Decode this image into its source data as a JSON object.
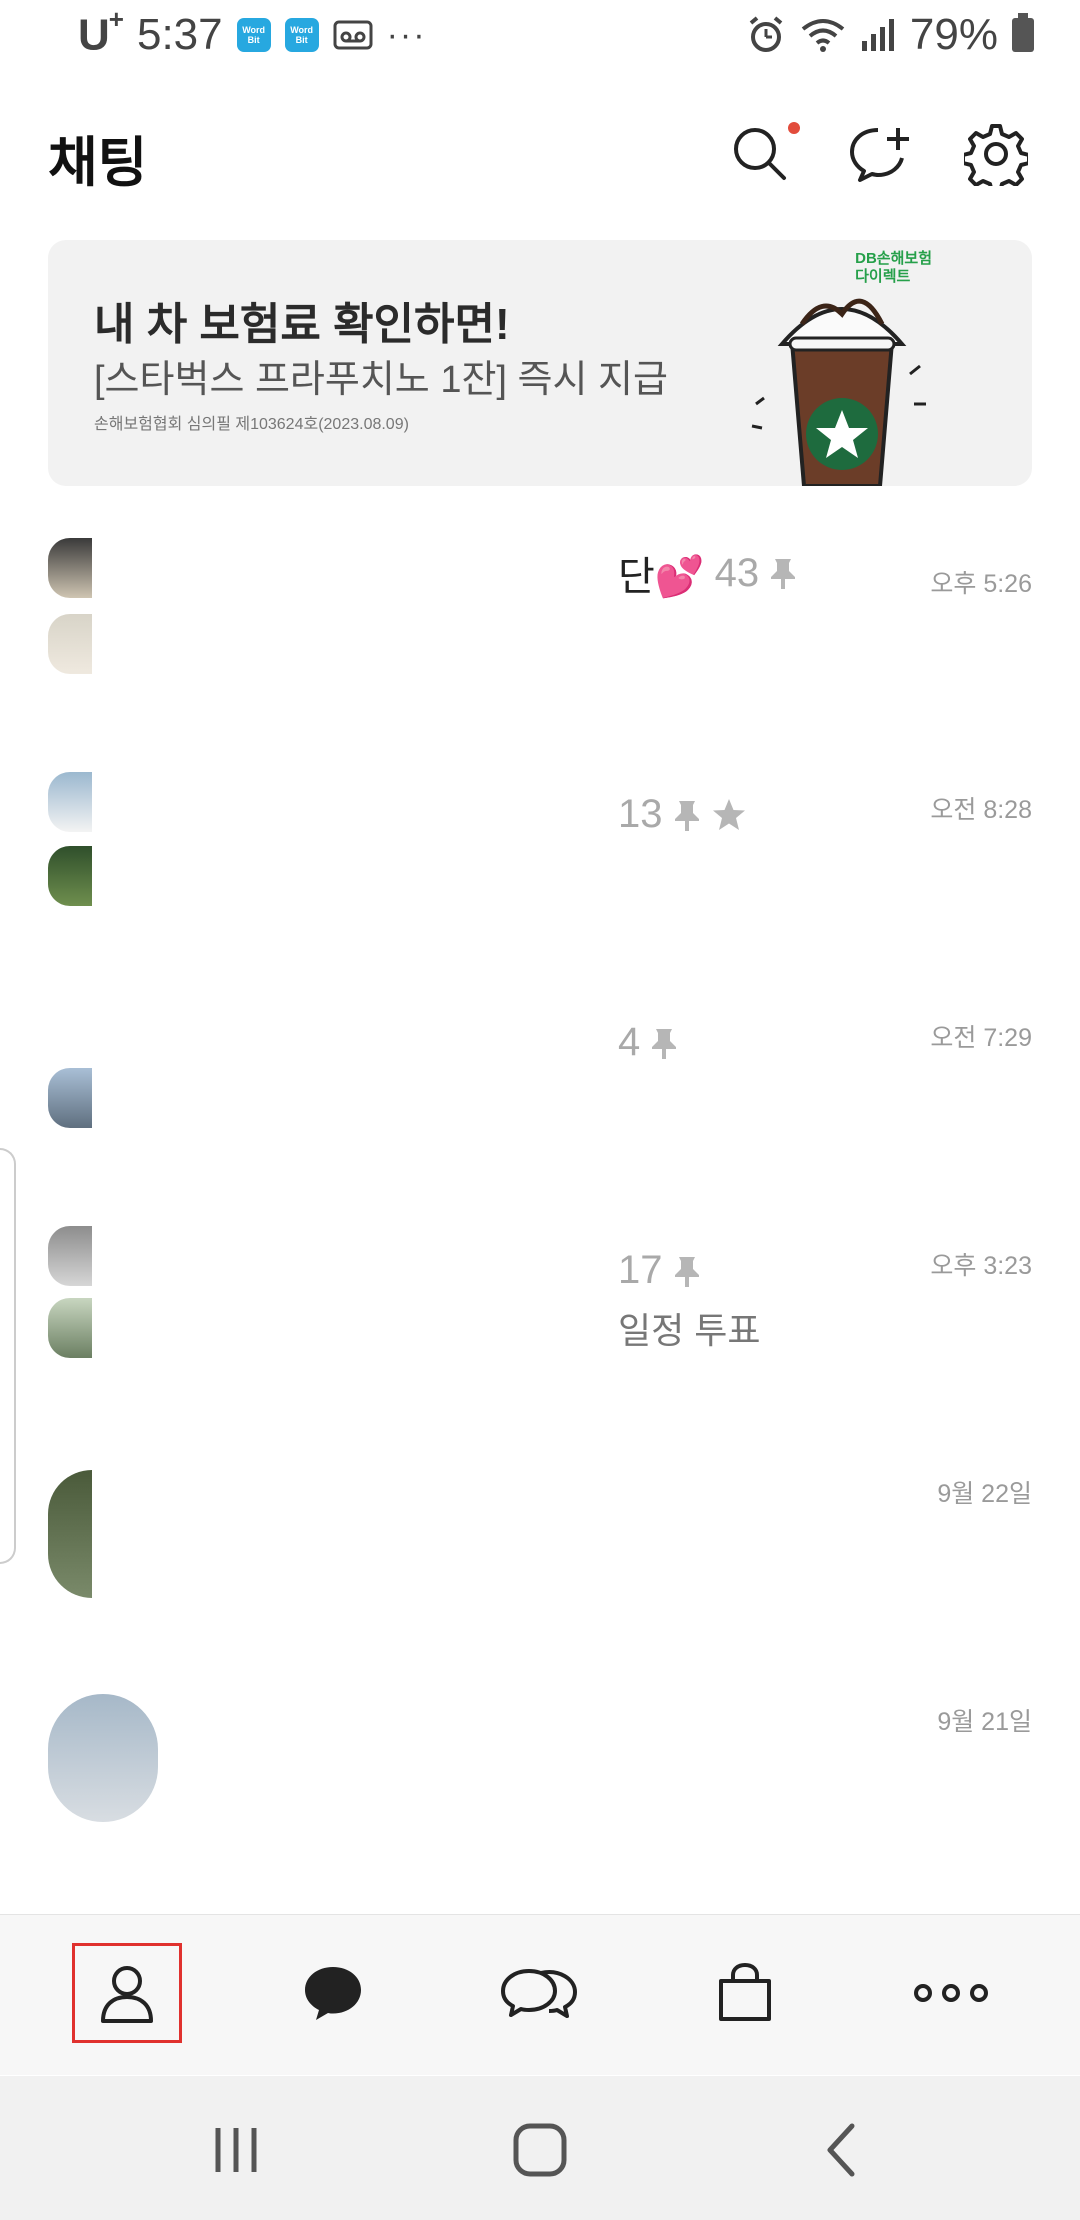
{
  "status_bar": {
    "carrier": "U",
    "carrier_sup": "+",
    "time": "5:37",
    "app_icon_1": "Word Bit",
    "app_icon_2": "Word Bit",
    "more": "···",
    "battery": "79%"
  },
  "header": {
    "title": "채팅",
    "icons": [
      "search-icon",
      "new-chat-icon",
      "settings-icon"
    ],
    "notification_color": "#e24c3c"
  },
  "banner": {
    "headline": "내 차 보험료 확인하면!",
    "subline": "[스타벅스 프라푸치노 1잔] 즉시 지급",
    "fineprint": "손해보험협회 심의필 제103624호(2023.08.09)",
    "brand_line1": "DB손해보험",
    "brand_line2": "다이렉트"
  },
  "chats": [
    {
      "prefix": "단",
      "emoji": "💕",
      "count": "43",
      "pinned": true,
      "starred": false,
      "time": "오후 5:26"
    },
    {
      "prefix": "",
      "emoji": "",
      "count": "13",
      "pinned": true,
      "starred": true,
      "time": "오전 8:28"
    },
    {
      "prefix": "",
      "emoji": "",
      "count": "4",
      "pinned": true,
      "starred": false,
      "time": "오전 7:29"
    },
    {
      "prefix": "",
      "emoji": "",
      "count": "17",
      "pinned": true,
      "starred": false,
      "time": "오후 3:23",
      "preview": "일정 투표"
    },
    {
      "prefix": "",
      "emoji": "",
      "count": "",
      "pinned": false,
      "starred": false,
      "time": "9월 22일"
    },
    {
      "prefix": "",
      "emoji": "",
      "count": "",
      "pinned": false,
      "starred": false,
      "time": "9월 21일"
    }
  ],
  "bottom_nav": {
    "items": [
      "friends-icon",
      "chats-icon",
      "openchat-icon",
      "shopping-icon",
      "more-icon"
    ],
    "active": "friends-icon",
    "active_highlight": "#e0312e"
  },
  "system_nav": [
    "recent-apps-icon",
    "home-icon",
    "back-icon"
  ]
}
